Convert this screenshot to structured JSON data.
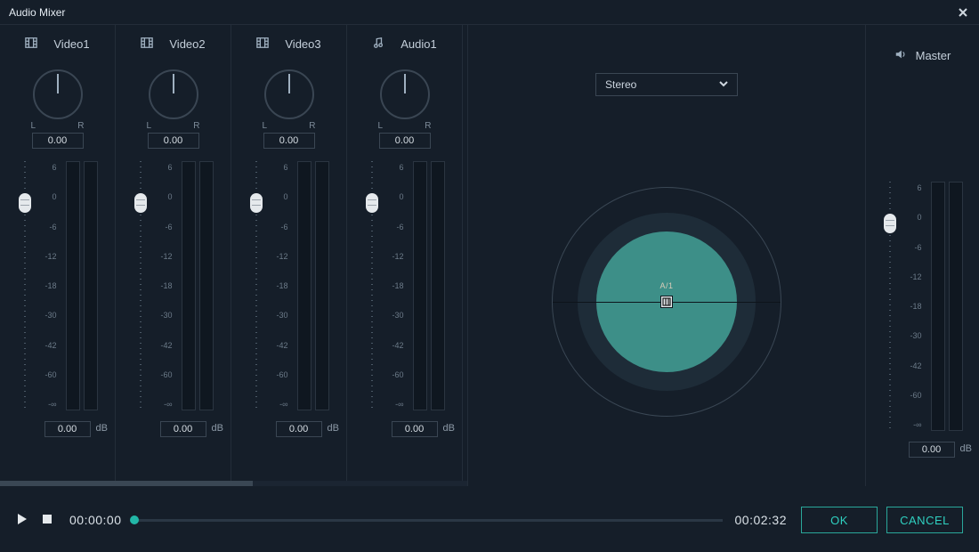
{
  "window": {
    "title": "Audio Mixer"
  },
  "tracks": [
    {
      "type": "video",
      "name": "Video1",
      "pan": "0.00",
      "db": "0.00"
    },
    {
      "type": "video",
      "name": "Video2",
      "pan": "0.00",
      "db": "0.00"
    },
    {
      "type": "video",
      "name": "Video3",
      "pan": "0.00",
      "db": "0.00"
    },
    {
      "type": "audio",
      "name": "Audio1",
      "pan": "0.00",
      "db": "0.00"
    }
  ],
  "scale": [
    "6",
    "0",
    "-6",
    "-12",
    "-18",
    "-30",
    "-42",
    "-60",
    "-∞"
  ],
  "lr": {
    "left": "L",
    "right": "R"
  },
  "unit": "dB",
  "panner": {
    "mode": "Stereo",
    "label": "A/1"
  },
  "master": {
    "name": "Master",
    "db": "0.00"
  },
  "playback": {
    "position": "00:00:00",
    "duration": "00:02:32"
  },
  "buttons": {
    "ok": "OK",
    "cancel": "CANCEL"
  },
  "colors": {
    "accent": "#22b7a7",
    "panner": "#3d8f88"
  }
}
